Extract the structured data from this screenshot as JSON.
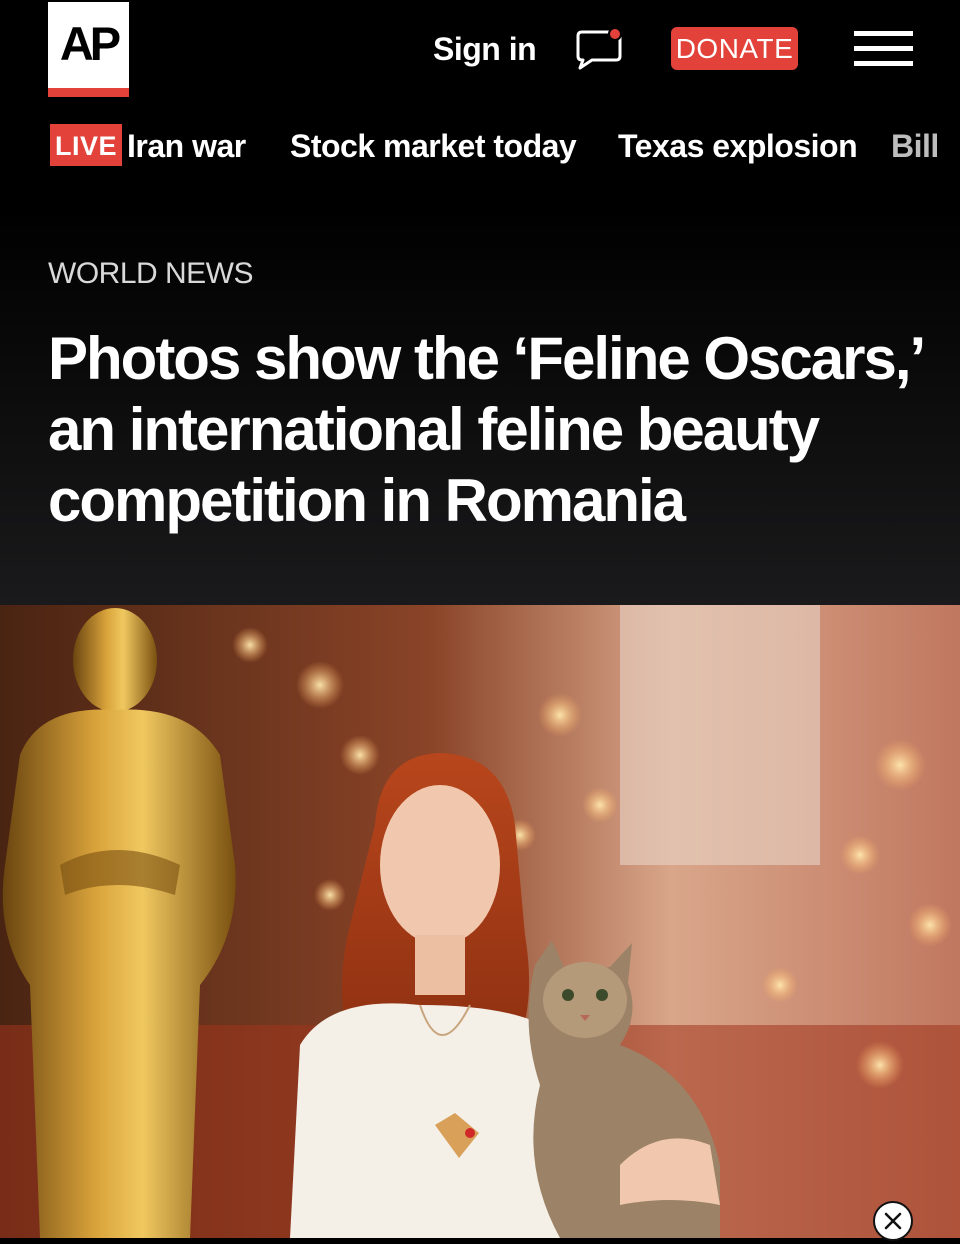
{
  "header": {
    "logo_text": "AP",
    "signin_label": "Sign in",
    "donate_label": "DONATE",
    "colors": {
      "accent": "#e2423a",
      "background": "#000000",
      "text": "#ffffff"
    },
    "icons": [
      "chat-icon",
      "notification-dot",
      "hamburger-menu-icon"
    ]
  },
  "trending": {
    "live_badge": "LIVE",
    "items": [
      "Iran war",
      "Stock market today",
      "Texas explosion",
      "Bill"
    ]
  },
  "article": {
    "section": "WORLD NEWS",
    "headline": "Photos show the ‘Feline Oscars,’ an international feline beauty competition in Romania"
  },
  "hero_image": {
    "description_icon": "photo",
    "close_icon": "close-icon"
  }
}
